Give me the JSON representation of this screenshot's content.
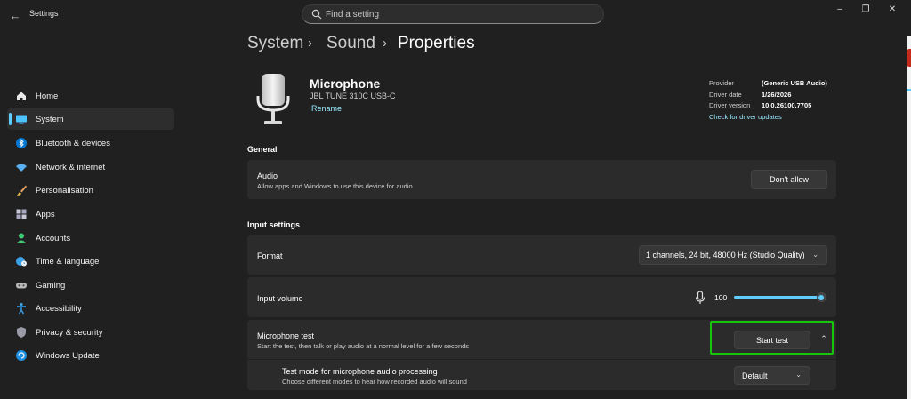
{
  "window": {
    "title": "Settings",
    "search_placeholder": "Find a setting"
  },
  "sidebar": {
    "items": [
      {
        "label": "Home",
        "icon": "home-icon"
      },
      {
        "label": "System",
        "icon": "system-icon",
        "active": true
      },
      {
        "label": "Bluetooth & devices",
        "icon": "bluetooth-icon"
      },
      {
        "label": "Network & internet",
        "icon": "wifi-icon"
      },
      {
        "label": "Personalisation",
        "icon": "brush-icon"
      },
      {
        "label": "Apps",
        "icon": "apps-icon"
      },
      {
        "label": "Accounts",
        "icon": "accounts-icon"
      },
      {
        "label": "Time & language",
        "icon": "globe-clock-icon"
      },
      {
        "label": "Gaming",
        "icon": "gamepad-icon"
      },
      {
        "label": "Accessibility",
        "icon": "accessibility-icon"
      },
      {
        "label": "Privacy & security",
        "icon": "shield-icon"
      },
      {
        "label": "Windows Update",
        "icon": "update-icon"
      }
    ]
  },
  "breadcrumb": [
    "System",
    "Sound",
    "Properties"
  ],
  "device": {
    "name": "Microphone",
    "model": "JBL TUNE 310C USB-C",
    "rename": "Rename",
    "provider_label": "Provider",
    "provider_value": "(Generic USB Audio)",
    "driver_date_label": "Driver date",
    "driver_date_value": "1/26/2026",
    "driver_version_label": "Driver version",
    "driver_version_value": "10.0.26100.7705",
    "check_updates": "Check for driver updates"
  },
  "general": {
    "heading": "General",
    "audio_title": "Audio",
    "audio_desc": "Allow apps and Windows to use this device for audio",
    "audio_button": "Don't allow"
  },
  "input_settings": {
    "heading": "Input settings",
    "format_label": "Format",
    "format_value": "1 channels, 24 bit, 48000 Hz (Studio Quality)",
    "volume_label": "Input volume",
    "volume_value": "100",
    "volume_level": 1.0,
    "mic_test_title": "Microphone test",
    "mic_test_desc": "Start the test, then talk or play audio at a normal level for a few seconds",
    "start_test": "Start test",
    "test_mode_title": "Test mode for microphone audio processing",
    "test_mode_desc": "Choose different modes to hear how recorded audio will sound",
    "test_mode_value": "Default"
  },
  "colors": {
    "accent": "#60cdff",
    "highlight": "#16c60c",
    "background": "#202020",
    "card": "#2b2b2b"
  }
}
